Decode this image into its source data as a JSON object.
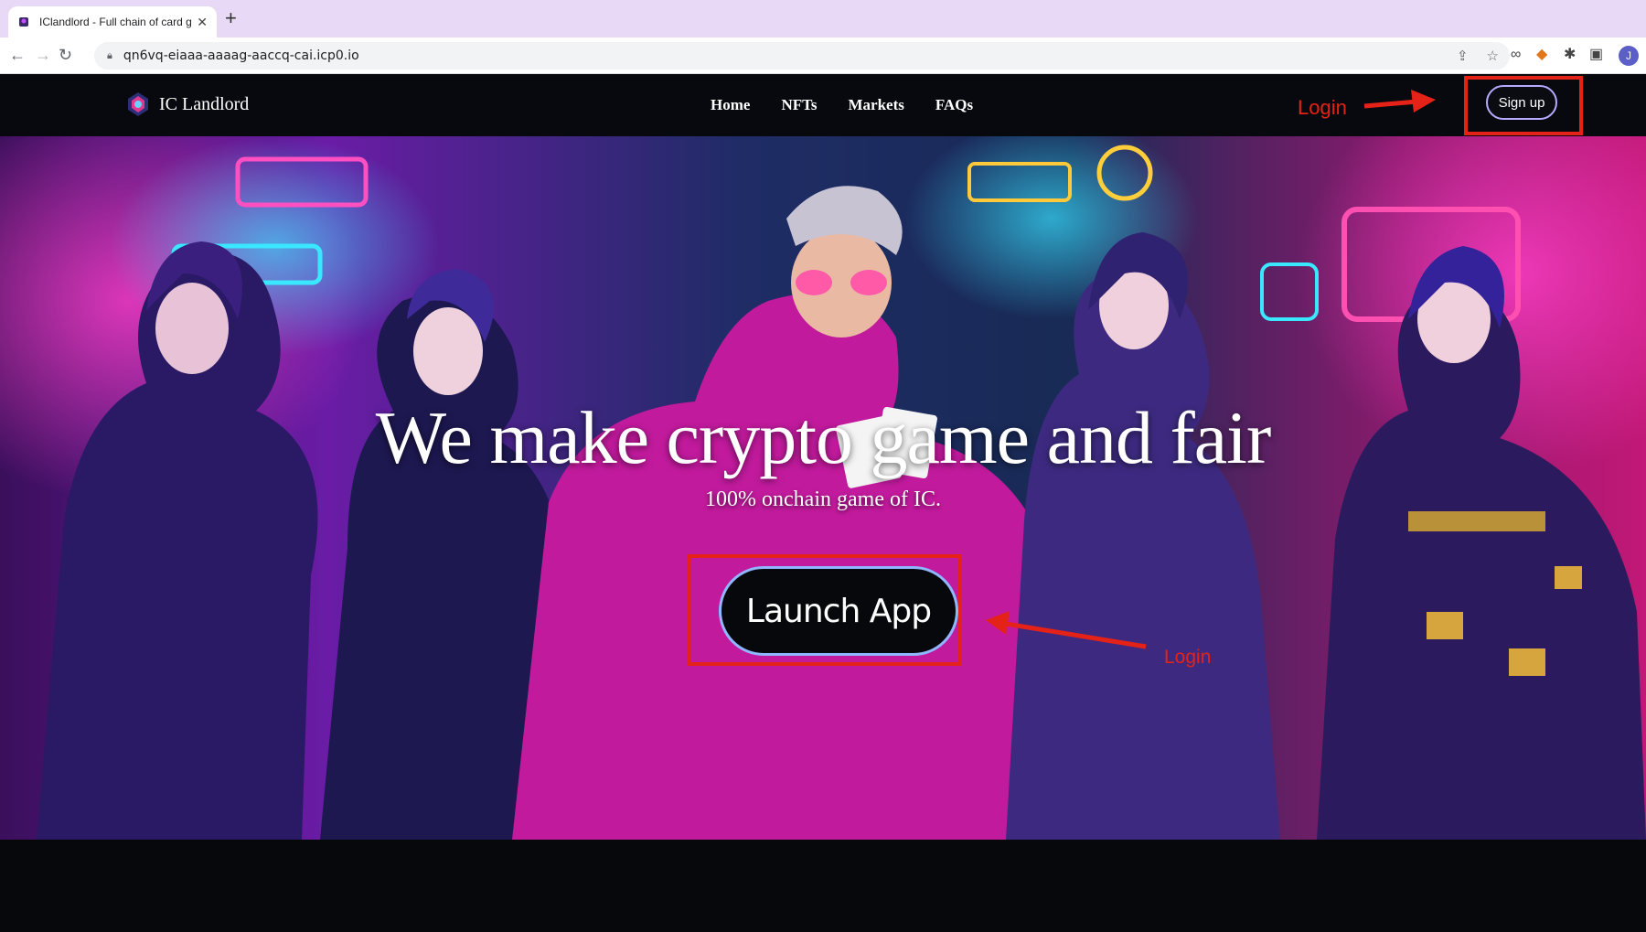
{
  "browser": {
    "tab_title": "IClandlord - Full chain of card g",
    "url": "qn6vq-eiaaa-aaaag-aaccq-cai.icp0.io",
    "profile_initial": "J"
  },
  "site": {
    "logo_text": "IC Landlord",
    "nav": [
      "Home",
      "NFTs",
      "Markets",
      "FAQs"
    ],
    "signup_label": "Sign up"
  },
  "hero": {
    "headline": "We make crypto game and fair",
    "subline": "100% onchain game of IC.",
    "launch_label": "Launch App"
  },
  "annotations": {
    "top_label": "Login",
    "button_label": "Login",
    "color": "#e52217"
  }
}
